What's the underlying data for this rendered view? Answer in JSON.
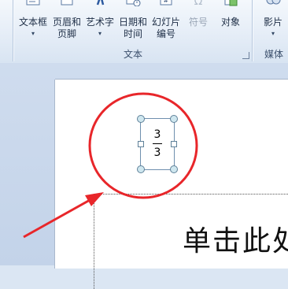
{
  "ribbon": {
    "text_group": {
      "label": "文本",
      "buttons": [
        {
          "line1": "文本框",
          "line2": "▾"
        },
        {
          "line1": "页眉和",
          "line2": "页脚"
        },
        {
          "line1": "艺术字",
          "line2": "▾"
        },
        {
          "line1": "日期和",
          "line2": "时间"
        },
        {
          "line1": "幻灯片",
          "line2": "编号"
        },
        {
          "line1": "符号",
          "line2": ""
        },
        {
          "line1": "对象",
          "line2": ""
        }
      ]
    },
    "media_group": {
      "label": "媒体",
      "buttons": [
        {
          "line1": "影片",
          "line2": "▾"
        }
      ]
    }
  },
  "slide": {
    "title_placeholder": "单击此处",
    "equation": {
      "numerator": "3",
      "denominator": "3"
    }
  },
  "annotation": {
    "circle_color": "#e8262a",
    "arrow_color": "#e8262a"
  }
}
